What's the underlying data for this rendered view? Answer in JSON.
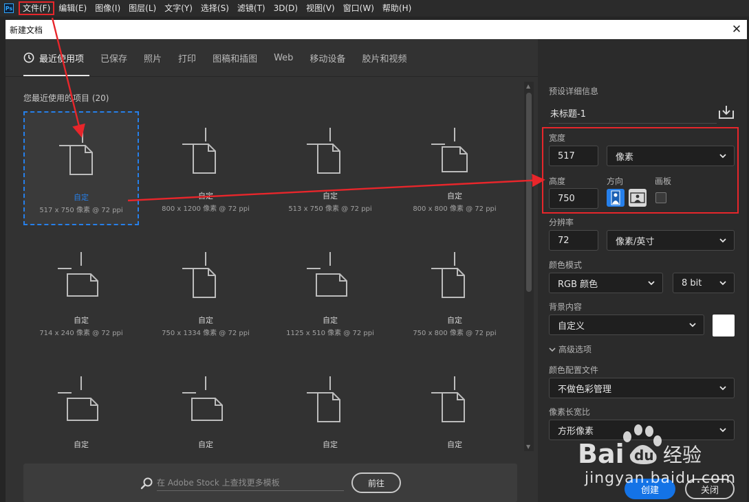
{
  "menubar": {
    "logo": "Ps",
    "items": [
      "文件(F)",
      "编辑(E)",
      "图像(I)",
      "图层(L)",
      "文字(Y)",
      "选择(S)",
      "滤镜(T)",
      "3D(D)",
      "视图(V)",
      "窗口(W)",
      "帮助(H)"
    ],
    "highlighted_index": 0
  },
  "dialog": {
    "title": "新建文档",
    "close_glyph": "✕"
  },
  "tabs": {
    "items": [
      "最近使用项",
      "已保存",
      "照片",
      "打印",
      "图稿和插图",
      "Web",
      "移动设备",
      "胶片和视频"
    ],
    "active_index": 0
  },
  "recent": {
    "heading": "您最近使用的项目 (20)",
    "presets": [
      {
        "name": "自定",
        "size": "517 x 750 像素 @ 72 ppi",
        "orientation": "portrait",
        "selected": true
      },
      {
        "name": "自定",
        "size": "800 x 1200 像素 @ 72 ppi",
        "orientation": "portrait",
        "selected": false
      },
      {
        "name": "自定",
        "size": "513 x 750 像素 @ 72 ppi",
        "orientation": "portrait",
        "selected": false
      },
      {
        "name": "自定",
        "size": "800 x 800 像素 @ 72 ppi",
        "orientation": "square",
        "selected": false
      },
      {
        "name": "自定",
        "size": "714 x 240 像素 @ 72 ppi",
        "orientation": "landscape",
        "selected": false
      },
      {
        "name": "自定",
        "size": "750 x 1334 像素 @ 72 ppi",
        "orientation": "portrait",
        "selected": false
      },
      {
        "name": "自定",
        "size": "1125 x 510 像素 @ 72 ppi",
        "orientation": "landscape",
        "selected": false
      },
      {
        "name": "自定",
        "size": "750 x 800 像素 @ 72 ppi",
        "orientation": "portrait",
        "selected": false
      },
      {
        "name": "自定",
        "size": "",
        "orientation": "landscape",
        "selected": false
      },
      {
        "name": "自定",
        "size": "",
        "orientation": "landscape",
        "selected": false
      },
      {
        "name": "自定",
        "size": "",
        "orientation": "portrait",
        "selected": false
      },
      {
        "name": "自定",
        "size": "",
        "orientation": "portrait",
        "selected": false
      }
    ]
  },
  "stock": {
    "placeholder": "在 Adobe Stock 上查找更多模板",
    "go_label": "前往"
  },
  "details": {
    "section_title": "预设详细信息",
    "doc_name": "未标题-1",
    "width_label": "宽度",
    "width_value": "517",
    "unit_value": "像素",
    "height_label": "高度",
    "height_value": "750",
    "orientation_label": "方向",
    "orientation_value": "portrait",
    "artboard_label": "画板",
    "artboard_checked": false,
    "resolution_label": "分辨率",
    "resolution_value": "72",
    "resolution_unit": "像素/英寸",
    "color_mode_label": "颜色模式",
    "color_mode_value": "RGB 颜色",
    "bit_depth_value": "8 bit",
    "background_label": "背景内容",
    "background_value": "自定义",
    "background_color": "#ffffff",
    "advanced_label": "高级选项",
    "profile_label": "颜色配置文件",
    "profile_value": "不做色彩管理",
    "pixel_ratio_label": "像素长宽比",
    "pixel_ratio_value": "方形像素",
    "create_label": "创建",
    "close_label": "关闭"
  },
  "colors": {
    "accent": "#2680eb",
    "annotation_red": "#e8262b",
    "primary_button": "#1473e6"
  },
  "watermark": {
    "logo_text": "Bai du 经验",
    "url": "jingyan.baidu.com"
  }
}
